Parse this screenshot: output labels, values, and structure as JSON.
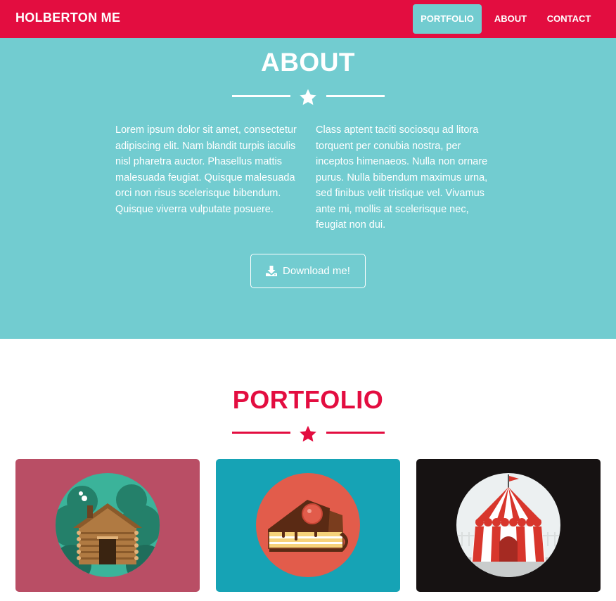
{
  "navbar": {
    "brand": "HOLBERTON ME",
    "items": [
      {
        "label": "PORTFOLIO",
        "active": true
      },
      {
        "label": "ABOUT",
        "active": false
      },
      {
        "label": "CONTACT",
        "active": false
      }
    ],
    "color": "#e30d40",
    "active_color": "#72ccd0"
  },
  "about": {
    "title": "ABOUT",
    "left_text": "Lorem ipsum dolor sit amet, consectetur adipiscing elit. Nam blandit turpis iaculis nisl pharetra auctor. Phasellus mattis malesuada feugiat. Quisque malesuada orci non risus scelerisque bibendum. Quisque viverra vulputate posuere.",
    "right_text": "Class aptent taciti sociosqu ad litora torquent per conubia nostra, per inceptos himenaeos. Nulla non ornare purus. Nulla bibendum maximus urna, sed finibus velit tristique vel. Vivamus ante mi, mollis at scelerisque nec, feugiat non dui.",
    "download_label": "Download me!",
    "download_icon": "download-icon",
    "background": "#72ccd0"
  },
  "portfolio": {
    "title": "PORTFOLIO",
    "items": [
      {
        "icon": "log-cabin-icon",
        "background": "#b94e65"
      },
      {
        "icon": "cake-slice-icon",
        "background": "#16a3b5"
      },
      {
        "icon": "circus-tent-icon",
        "background": "#161212"
      }
    ]
  }
}
